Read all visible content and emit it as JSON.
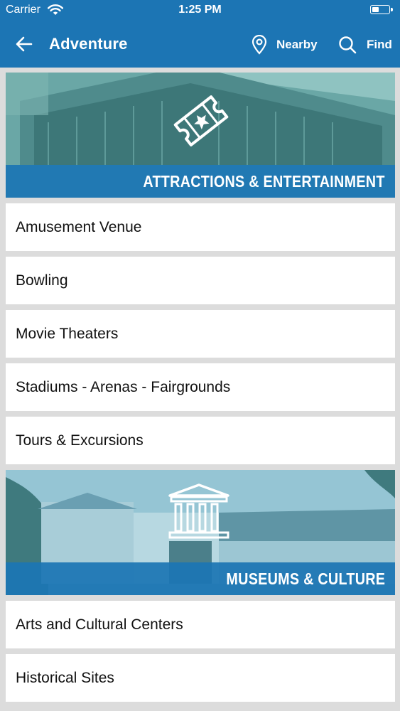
{
  "status_bar": {
    "carrier": "Carrier",
    "time": "1:25 PM"
  },
  "nav": {
    "title": "Adventure",
    "nearby_label": "Nearby",
    "find_label": "Find"
  },
  "sections": [
    {
      "title": "ATTRACTIONS & ENTERTAINMENT",
      "items": [
        "Amusement Venue",
        "Bowling",
        "Movie Theaters",
        "Stadiums - Arenas - Fairgrounds",
        "Tours & Excursions"
      ]
    },
    {
      "title": "MUSEUMS & CULTURE",
      "items": [
        "Arts and Cultural Centers",
        "Historical Sites"
      ]
    }
  ],
  "colors": {
    "primary": "#1c75b4",
    "background": "#dcdcdc"
  }
}
